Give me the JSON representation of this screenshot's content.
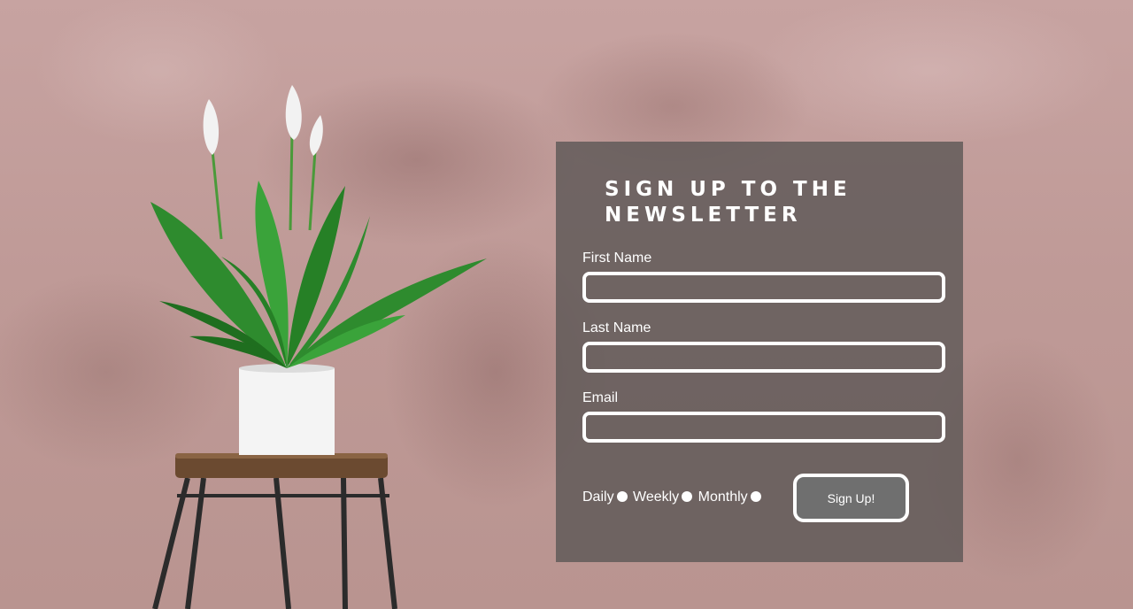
{
  "newsletter": {
    "title": "Sign Up to the Newsletter",
    "fields": [
      {
        "label": "First Name",
        "value": "",
        "placeholder": ""
      },
      {
        "label": "Last Name",
        "value": "",
        "placeholder": ""
      },
      {
        "label": "Email",
        "value": "",
        "placeholder": ""
      }
    ],
    "frequency_options": [
      "Daily",
      "Weekly",
      "Monthly"
    ],
    "submit_label": "Sign Up!"
  },
  "colors": {
    "wall": "#c7a3a1",
    "panel": "#585453",
    "text": "#ffffff",
    "button": "#6f6f6f",
    "leaf": "#2e8b2e",
    "pot": "#f4f4f4",
    "stool_top": "#6b4a30",
    "stool_legs": "#2b2b2b"
  }
}
